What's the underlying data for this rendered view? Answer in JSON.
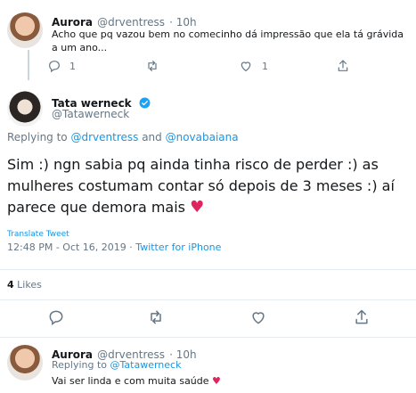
{
  "reply_top": {
    "name": "Aurora",
    "handle": "@drventress",
    "time": "· 10h",
    "text": "Acho que pq vazou bem no comecinho dá impressão que ela tá grávida a um ano...",
    "reply_count": "1",
    "retweet_count": "",
    "like_count": "1"
  },
  "main_tweet": {
    "name": "Tata werneck",
    "handle": "@Tatawerneck",
    "replying_prefix": "Replying to ",
    "replying_users": [
      "@drventress",
      "@novabaiana"
    ],
    "replying_joiner": " and ",
    "text": "Sim :) ngn sabia pq ainda tinha risco de perder :) as mulheres costumam contar só depois de 3 meses :) aí parece que demora mais",
    "emoji": "♥",
    "translate": "Translate Tweet",
    "time": "12:48 PM - Oct 16, 2019",
    "dot": " · ",
    "source": "Twitter for iPhone",
    "likes_count": "4",
    "likes_label": "Likes"
  },
  "reply_bottom": {
    "name": "Aurora",
    "handle": "@drventress",
    "time": "· 10h",
    "replying_prefix": "Replying to ",
    "replying_user": "@Tatawerneck",
    "text": "Vai ser linda e com muita saúde",
    "emoji": "♥"
  },
  "colors": {
    "accent": "#1b95e0",
    "verified": "#1da1f2",
    "heart": "#e0245e",
    "muted": "#657786",
    "divider": "#e6ecf0"
  },
  "icons": [
    "reply-icon",
    "retweet-icon",
    "like-icon",
    "share-icon",
    "verified-icon"
  ]
}
